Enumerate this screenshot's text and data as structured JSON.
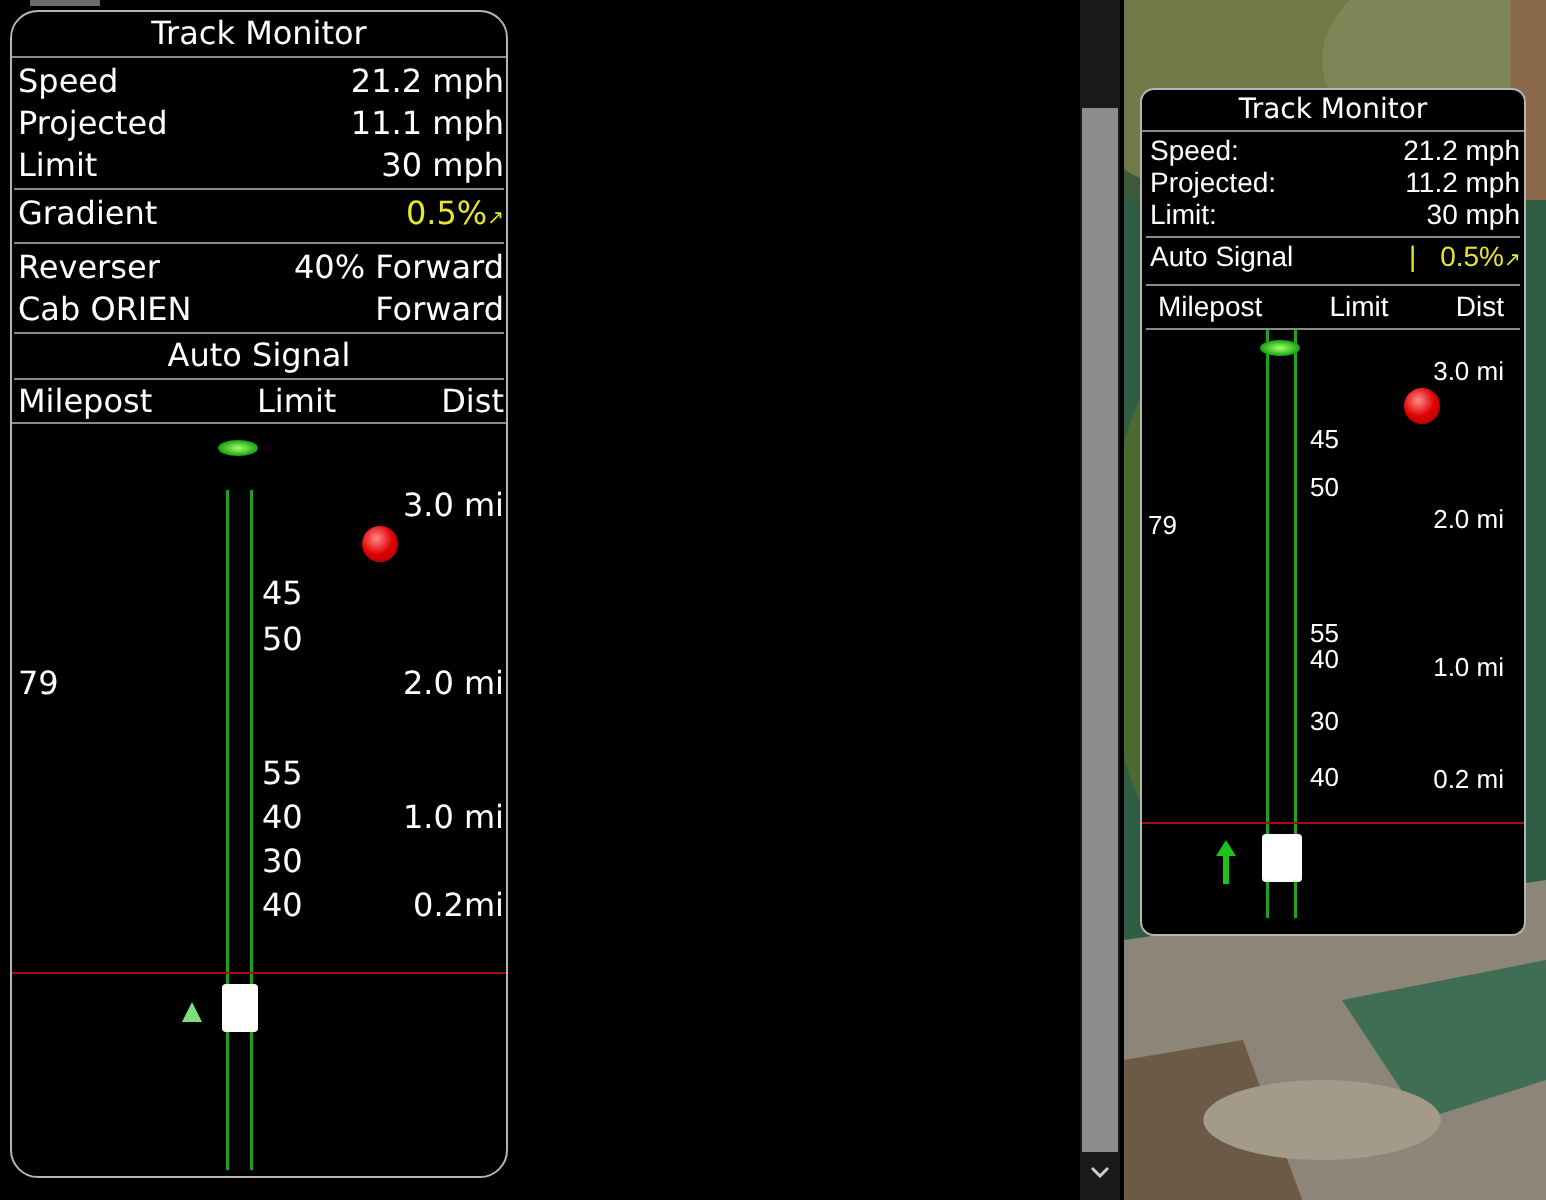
{
  "monitors": [
    {
      "title": "Track Monitor",
      "sections": [
        {
          "kind": "rows",
          "rows": [
            {
              "label": "Speed",
              "value": "21.2 mph"
            },
            {
              "label": "Projected",
              "value": "11.1 mph"
            },
            {
              "label": "Limit",
              "value": "30 mph"
            }
          ]
        },
        {
          "kind": "highlight",
          "rows": [
            {
              "label": "Gradient",
              "value": "0.5%",
              "arrow": "↗"
            }
          ]
        },
        {
          "kind": "rows",
          "rows": [
            {
              "label": "Reverser",
              "value": "40% Forward"
            },
            {
              "label": "Cab ORIEN",
              "value": "Forward"
            }
          ]
        },
        {
          "kind": "heading",
          "text": "Auto Signal"
        }
      ],
      "columns": [
        "Milepost",
        "Limit",
        "Dist"
      ],
      "mileposts": [
        "79"
      ],
      "limits": [
        "45",
        "50",
        "55",
        "40",
        "30",
        "40"
      ],
      "distances": [
        "3.0 mi",
        "2.0 mi",
        "1.0 mi",
        "0.2mi"
      ]
    },
    {
      "title": "Track Monitor",
      "sections": [
        {
          "kind": "rows",
          "rows": [
            {
              "label": "Speed:",
              "value": "21.2 mph"
            },
            {
              "label": "Projected:",
              "value": "11.2 mph"
            },
            {
              "label": "Limit:",
              "value": "30 mph"
            }
          ]
        },
        {
          "kind": "highlight",
          "rows": [
            {
              "label": "Auto Signal",
              "mark": "|",
              "value": "0.5%",
              "arrow": "↗"
            }
          ]
        }
      ],
      "columns": [
        "Milepost",
        "Limit",
        "Dist"
      ],
      "mileposts": [
        "79"
      ],
      "limits": [
        "45",
        "50",
        "55",
        "40",
        "30",
        "40"
      ],
      "distances": [
        "3.0 mi",
        "2.0 mi",
        "1.0 mi",
        "0.2 mi"
      ]
    }
  ]
}
